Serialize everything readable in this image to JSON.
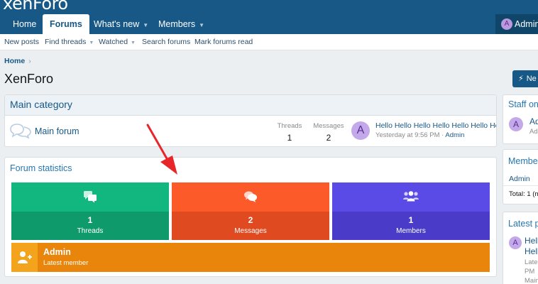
{
  "header": {
    "logo": "xenForo",
    "tabs": [
      {
        "label": "Home"
      },
      {
        "label": "Forums"
      },
      {
        "label": "What's new"
      },
      {
        "label": "Members"
      }
    ],
    "user": {
      "initial": "A",
      "name": "Admin"
    }
  },
  "subnav": {
    "items": [
      {
        "label": "New posts"
      },
      {
        "label": "Find threads"
      },
      {
        "label": "Watched"
      },
      {
        "label": "Search forums"
      },
      {
        "label": "Mark forums read"
      }
    ]
  },
  "breadcrumb": {
    "home": "Home",
    "sep": "›"
  },
  "page": {
    "title": "XenForo",
    "new_button": "Ne"
  },
  "category": {
    "title": "Main category",
    "forum": {
      "name": "Main forum",
      "threads_label": "Threads",
      "threads": "1",
      "messages_label": "Messages",
      "messages": "2",
      "last_post": {
        "initial": "A",
        "title": "Hello Hello Hello Hello Hello Hello Hello",
        "time": "Yesterday at 9:56 PM",
        "dot": "·",
        "author": "Admin"
      }
    }
  },
  "stats": {
    "title": "Forum statistics",
    "tiles": [
      {
        "value": "1",
        "label": "Threads",
        "color": "#12b780",
        "color_dark": "#0f9a6c"
      },
      {
        "value": "2",
        "label": "Messages",
        "color": "#fd5a2a",
        "color_dark": "#e04a20"
      },
      {
        "value": "1",
        "label": "Members",
        "color": "#5a4ae6",
        "color_dark": "#4a3cc8"
      }
    ],
    "latest": {
      "name": "Admin",
      "label": "Latest member",
      "color": "#e8850a"
    }
  },
  "sidebar": {
    "staff": {
      "title": "Staff on",
      "initial": "A",
      "name": "Ad",
      "role": "Adi"
    },
    "members": {
      "title": "Membe",
      "name": "Admin",
      "total": "Total: 1 (m"
    },
    "latest": {
      "title": "Latest p",
      "initial": "A",
      "line1": "Hell",
      "line2": "Hell",
      "meta1": "Late",
      "meta2": "PM",
      "meta3": "Main"
    }
  },
  "colors": {
    "header": "#185886",
    "link": "#185886",
    "annotation_arrow": "#e8262a"
  }
}
